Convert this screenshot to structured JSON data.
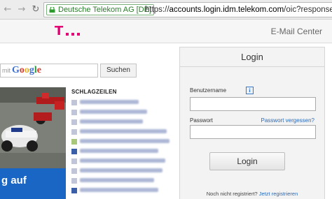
{
  "browser": {
    "back_icon": "arrow-left-icon",
    "forward_icon": "arrow-right-icon",
    "reload_icon": "reload-icon",
    "security_label": "Deutsche Telekom AG [DE]",
    "url_scheme": "https://",
    "url_host": "accounts.login.idm.telekom.com",
    "url_path": "/oic?response_"
  },
  "header": {
    "logo_icon": "telekom-t-logo",
    "brand_color": "#e20074",
    "title": "E-Mail Center"
  },
  "search": {
    "prefix": "mit",
    "brand": "Google",
    "button_label": "Suchen"
  },
  "news": {
    "photo_caption": "g auf",
    "headlines_title": "SCHLAGZEILEN",
    "headline_count_visible": 10
  },
  "login": {
    "title": "Login",
    "username_label": "Benutzername",
    "info_icon": "info-icon",
    "password_label": "Passwort",
    "forgot_password_link": "Passwort vergessen?",
    "submit_label": "Login",
    "register_text": "Noch nicht registriert?",
    "register_link": "Jetzt registrieren"
  }
}
